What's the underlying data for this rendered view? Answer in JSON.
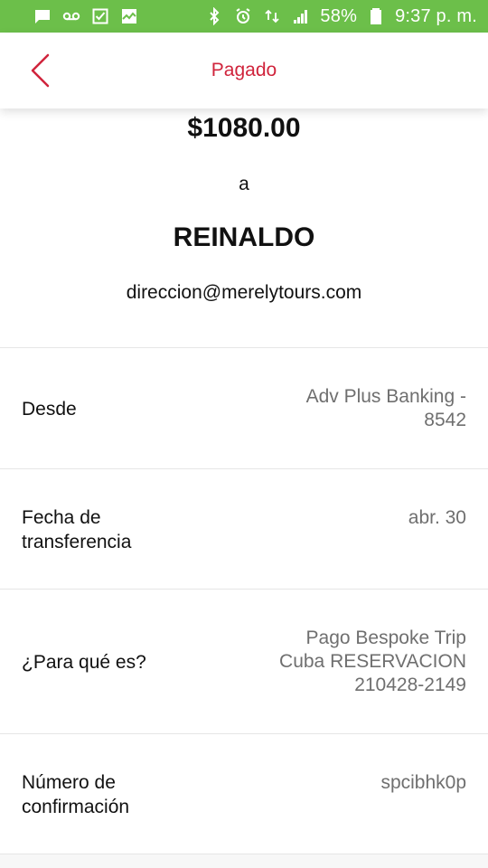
{
  "status_bar": {
    "battery_percent": "58%",
    "time": "9:37 p. m.",
    "left_icons": [
      "message-icon",
      "voicemail-icon",
      "checkbox-icon",
      "activity-icon"
    ],
    "right_icons": [
      "bluetooth-icon",
      "alarm-icon",
      "data-icon",
      "signal-icon",
      "battery-icon"
    ],
    "color": "#6cbf4a"
  },
  "app_bar": {
    "title": "Pagado",
    "back_icon": "chevron-left-icon",
    "accent_color": "#d0243c"
  },
  "summary": {
    "amount": "$1080.00",
    "to_label": "a",
    "recipient_name": "REINALDO",
    "recipient_email": "direccion@merelytours.com"
  },
  "details": [
    {
      "label": "Desde",
      "value": "Adv Plus Banking -\n8542"
    },
    {
      "label": "Fecha de\ntransferencia",
      "value": "abr. 30"
    },
    {
      "label": "¿Para qué es?",
      "value": "Pago Bespoke Trip\nCuba RESERVACION\n210428-2149"
    },
    {
      "label": "Número de\nconfirmación",
      "value": "spcibhk0p"
    }
  ]
}
